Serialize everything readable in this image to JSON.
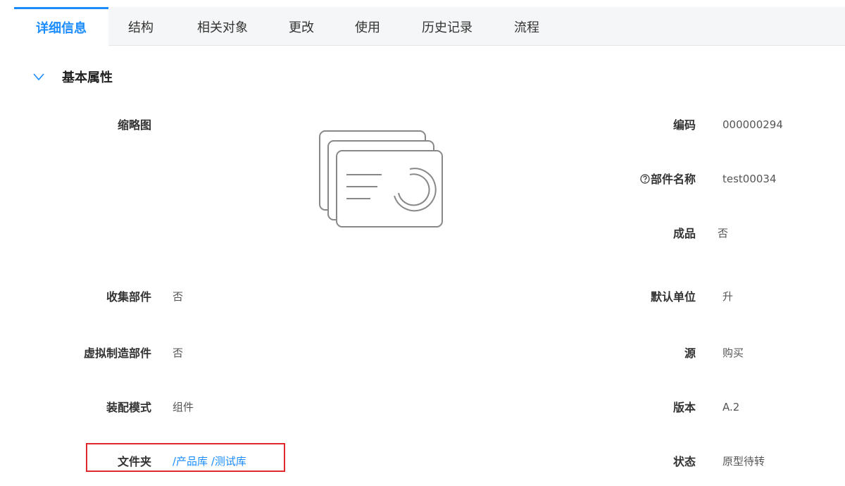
{
  "tabs": [
    {
      "label": "详细信息",
      "active": true
    },
    {
      "label": "结构"
    },
    {
      "label": "相关对象"
    },
    {
      "label": "更改"
    },
    {
      "label": "使用"
    },
    {
      "label": "历史记录"
    },
    {
      "label": "流程"
    }
  ],
  "section": {
    "title": "基本属性",
    "expanded": true
  },
  "left_fields": {
    "thumbnail_label": "缩略图",
    "collect_part": {
      "label": "收集部件",
      "value": "否"
    },
    "virtual_part": {
      "label": "虚拟制造部件",
      "value": "否"
    },
    "assembly_mode": {
      "label": "装配模式",
      "value": "组件"
    },
    "folder": {
      "label": "文件夹",
      "value": "/产品库 /测试库"
    }
  },
  "right_fields": {
    "code": {
      "label": "编码",
      "value": "000000294"
    },
    "part_name": {
      "label": "部件名称",
      "value": "test00034"
    },
    "finished": {
      "label": "成品",
      "value": "否"
    },
    "default_unit": {
      "label": "默认单位",
      "value": "升"
    },
    "source": {
      "label": "源",
      "value": "购买"
    },
    "version": {
      "label": "版本",
      "value": "A.2"
    },
    "status": {
      "label": "状态",
      "value": "原型待转"
    }
  },
  "colors": {
    "accent": "#1a8cff",
    "highlight": "#e0282e"
  }
}
